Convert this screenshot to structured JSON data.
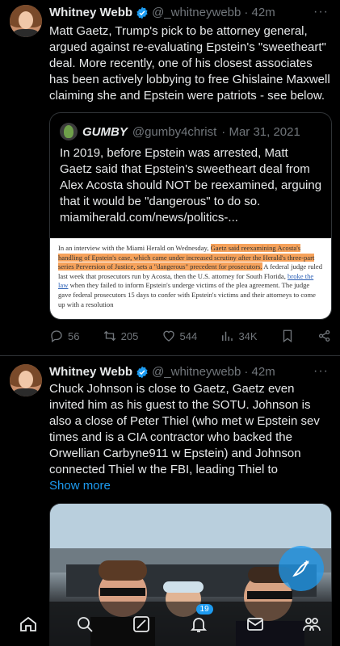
{
  "tweets": [
    {
      "author_name": "Whitney Webb",
      "handle": "@_whitneywebb",
      "time": "· 42m",
      "text": "Matt Gaetz, Trump's pick to be attorney general, argued against re-evaluating Epstein's \"sweetheart\" deal. More recently, one of his closest associates has been actively lobbying to free Ghislaine Maxwell claiming she and Epstein were patriots - see below.",
      "quote": {
        "author_name": "GUMBY",
        "handle": "@gumby4christ",
        "time": "· Mar 31, 2021",
        "text": "In 2019, before Epstein was arrested, Matt Gaetz said that Epstein's sweetheart deal from Alex Acosta should NOT be reexamined, arguing that it would be \"dangerous\" to do so.",
        "link": "miamiherald.com/news/politics-...",
        "article": {
          "p1": "In an interview with the Miami Herald on Wednesday,",
          "p1_highlight": "Gaetz said reexamining Acosta's handling of Epstein's case, which came under increased scrutiny after the Herald's three-part series Perversion of Justice, sets a \"dangerous\" precedent for prosecutors.",
          "p2": "A federal judge ruled last week that prosecutors run by Acosta, then the U.S. attorney for South Florida,",
          "p2_link": "broke the law",
          "p2_rest": "when they failed to inform Epstein's underge victims of the plea agreement. The judge gave federal prosecutors 15 days to confer with Epstein's victims and their attorneys to come up with a resolution"
        }
      },
      "stats": {
        "replies": "56",
        "reposts": "205",
        "likes": "544",
        "views": "34K"
      }
    },
    {
      "author_name": "Whitney Webb",
      "handle": "@_whitneywebb",
      "time": "· 42m",
      "text": "Chuck Johnson is close to Gaetz, Gaetz even invited him as his guest to the SOTU. Johnson is also a close of Peter Thiel (who met w Epstein sev times and is a CIA contractor who backed the Orwellian Carbyne911 w Epstein) and Johnson connected Thiel w the FBI, leading Thiel to",
      "show_more": "Show more"
    }
  ],
  "more_label": "···",
  "nav": {
    "notifications_badge": "19"
  },
  "colors": {
    "background": "#000000",
    "accent": "#1d9bf0",
    "text": "#e7e9ea",
    "muted": "#71767b",
    "highlight": "#f6a25b"
  },
  "icons": [
    "verified-badge-icon",
    "more-icon",
    "reply-icon",
    "repost-icon",
    "like-icon",
    "views-icon",
    "bookmark-icon",
    "share-icon",
    "home-icon",
    "search-icon",
    "grok-icon",
    "notifications-icon",
    "messages-icon",
    "communities-icon",
    "compose-icon"
  ]
}
